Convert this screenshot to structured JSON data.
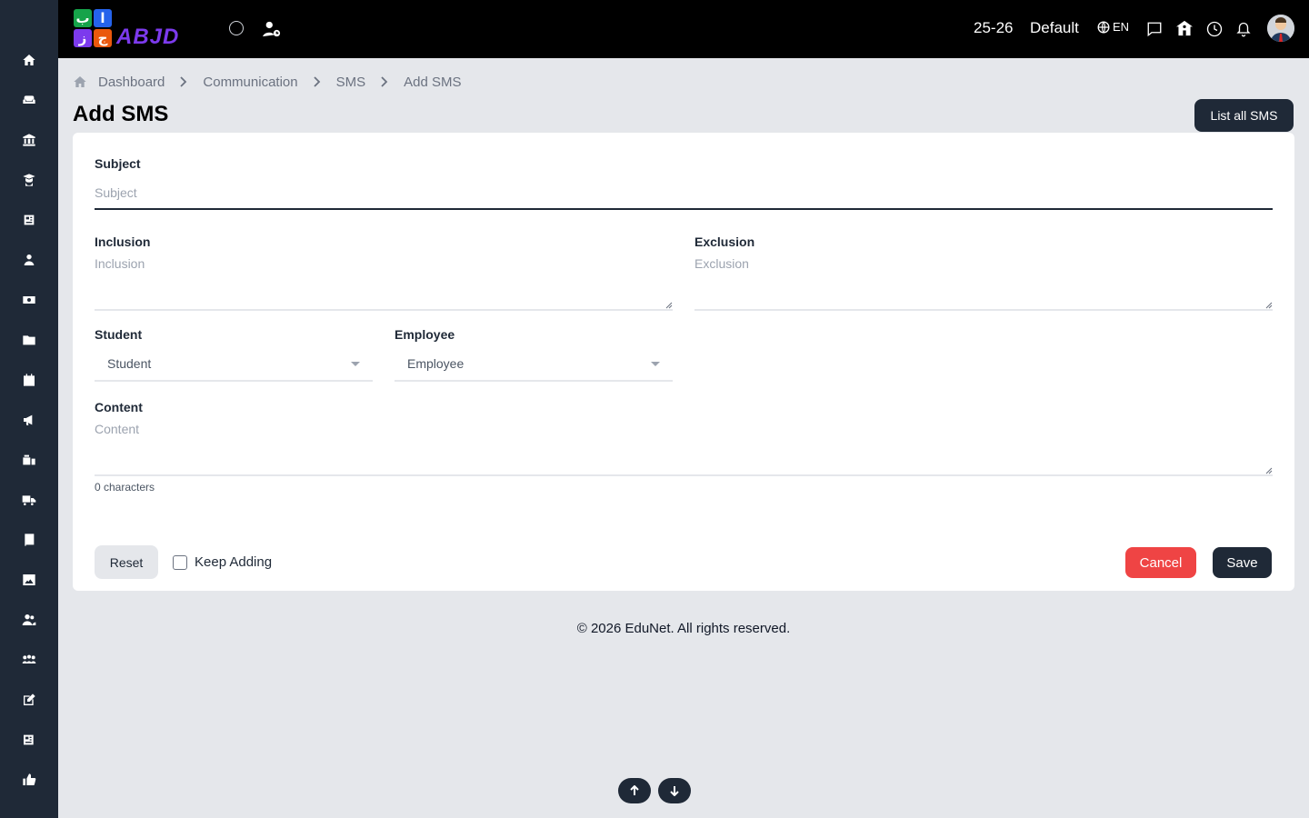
{
  "sidebar": {
    "icons": [
      "home-icon",
      "sofa-icon",
      "bank-icon",
      "graduate-icon",
      "newspaper-icon",
      "teacher-icon",
      "money-icon",
      "folder-icon",
      "calendar-icon",
      "megaphone-icon",
      "inventory-icon",
      "truck-icon",
      "book-icon",
      "image-icon",
      "users-icon",
      "group-icon",
      "edit-icon",
      "news-icon",
      "thumbs-up-icon"
    ]
  },
  "topbar": {
    "logo_text": "ABJD",
    "session": "25-26",
    "profile": "Default",
    "lang": "EN"
  },
  "breadcrumb": {
    "items": [
      "Dashboard",
      "Communication",
      "SMS",
      "Add SMS"
    ]
  },
  "page": {
    "title": "Add SMS",
    "list_button": "List all SMS"
  },
  "form": {
    "subject_label": "Subject",
    "subject_placeholder": "Subject",
    "inclusion_label": "Inclusion",
    "inclusion_placeholder": "Inclusion",
    "exclusion_label": "Exclusion",
    "exclusion_placeholder": "Exclusion",
    "student_label": "Student",
    "student_value": "Student",
    "employee_label": "Employee",
    "employee_value": "Employee",
    "content_label": "Content",
    "content_placeholder": "Content",
    "char_count": "0 characters",
    "reset_label": "Reset",
    "keep_adding_label": "Keep Adding",
    "cancel_label": "Cancel",
    "save_label": "Save"
  },
  "footer": {
    "text": "© 2026 EduNet. All rights reserved."
  },
  "colors": {
    "sidebar_bg": "#1f2937",
    "topbar_bg": "#000000",
    "page_bg": "#e5e7eb",
    "primary_dark": "#1f2937",
    "cancel_red": "#ef4444"
  }
}
